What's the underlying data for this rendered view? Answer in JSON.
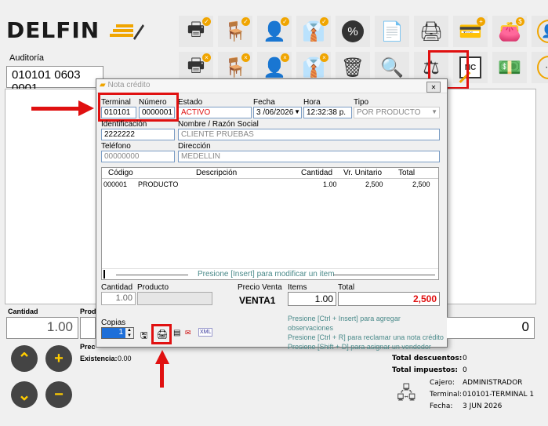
{
  "app": {
    "logo": "DELFIN",
    "section_label": "Auditoría",
    "doc_number": "010101 0603 0001"
  },
  "toolbar": {
    "row1": [
      "printer-icon",
      "receptionist-icon",
      "cashier-icon",
      "seller-icon",
      "percent-icon",
      "document-icon",
      "print-doc-icon",
      "card-icon",
      "wallet-icon",
      "user-icon"
    ],
    "row2": [
      "printer-x-icon",
      "desk-x-icon",
      "cashier-x-icon",
      "seller-x-icon",
      "trash-icon",
      "search-icon",
      "scale-icon",
      "credit-note-icon",
      "money-icon",
      "more-icon"
    ],
    "credit_note_label": "NC",
    "percent_symbol": "%"
  },
  "dialog": {
    "title": "Nota crédito",
    "labels": {
      "terminal": "Terminal",
      "numero": "Número",
      "estado": "Estado",
      "fecha": "Fecha",
      "hora": "Hora",
      "tipo": "Tipo",
      "identificacion": "Identificación",
      "nombre": "Nombre / Razón Social",
      "telefono": "Teléfono",
      "direccion": "Dirección"
    },
    "values": {
      "terminal": "010101",
      "numero": "0000001",
      "estado": "ACTIVO",
      "fecha": "3 /06/2026",
      "hora": "12:32:38 p.",
      "tipo": "POR PRODUCTO",
      "identificacion": "2222222",
      "nombre": "CLIENTE PRUEBAS",
      "telefono": "00000000",
      "direccion": "MEDELLIN"
    },
    "grid": {
      "headers": [
        "Código",
        "Descripción",
        "Cantidad",
        "Vr. Unitario",
        "Total"
      ],
      "rows": [
        [
          "000001",
          "PRODUCTO",
          "1.00",
          "2,500",
          "2,500"
        ]
      ],
      "hint": "Presione [Insert] para modificar un item"
    },
    "bottom": {
      "cantidad_label": "Cantidad",
      "producto_label": "Producto",
      "precio_venta_label": "Precio Venta",
      "items_label": "Items",
      "total_label": "Total",
      "cantidad": "1.00",
      "precio_venta": "VENTA1",
      "items": "1.00",
      "total": "2,500",
      "copias_label": "Copias",
      "copias": "1",
      "xml": "XML"
    },
    "hints": [
      "Presione [Ctrl + Insert] para agregar observaciones",
      "Presione [Ctrl + R] para reclamar una nota crédito",
      "Presione [Shift + D] para asignar un vendedor"
    ]
  },
  "main": {
    "cantidad_label": "Cantidad",
    "cantidad": "1.00",
    "producto_label": "Prod",
    "precio_label": "Prec",
    "existencia_label": "Existencia:",
    "existencia": "0.00",
    "total": "0"
  },
  "status": {
    "descuentos_label": "Total descuentos:",
    "descuentos": "0",
    "impuestos_label": "Total impuestos:",
    "impuestos": "0",
    "cajero_label": "Cajero:",
    "cajero": "ADMINISTRADOR",
    "terminal_label": "Terminal:",
    "terminal": "010101-TERMINAL 1",
    "fecha_label": "Fecha:",
    "fecha": "3 JUN 2026"
  },
  "colors": {
    "accent_red": "#e01010",
    "logo_yellow": "#f0a500",
    "status_red": "#e01010"
  }
}
